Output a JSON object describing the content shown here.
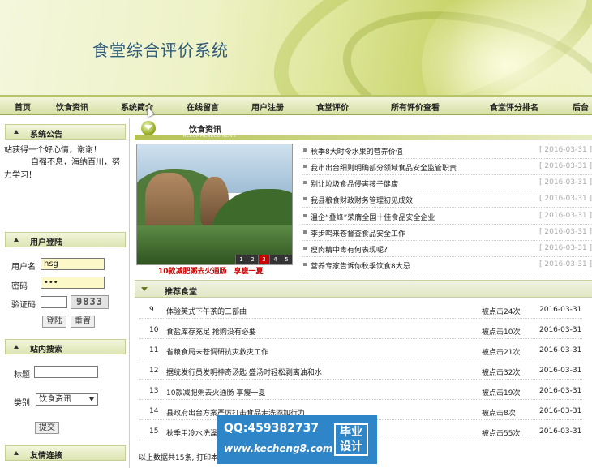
{
  "banner": {
    "title": "食堂综合评价系统"
  },
  "nav": [
    {
      "label": "首页"
    },
    {
      "label": "饮食资讯"
    },
    {
      "label": "系统简介"
    },
    {
      "label": "在线留言"
    },
    {
      "label": "用户注册"
    },
    {
      "label": "食堂评价"
    },
    {
      "label": "所有评价查看"
    },
    {
      "label": "食堂评分排名"
    },
    {
      "label": "后台"
    }
  ],
  "sidebar": {
    "notice": {
      "title": "系统公告",
      "line1": "站获得一个好心情，谢谢！",
      "line2": "自强不息，海纳百川，努力学习！"
    },
    "login": {
      "title": "用户登陆",
      "username_label": "用户名",
      "username_value": "hsg",
      "password_label": "密码",
      "password_value": "•••",
      "captcha_label": "验证码",
      "captcha_value": "",
      "captcha_image_text": "9833",
      "login_button": "登陆",
      "reset_button": "重置"
    },
    "search": {
      "title": "站内搜索",
      "title_label": "标题",
      "title_value": "",
      "category_label": "类别",
      "category_value": "饮食资讯",
      "submit_button": "提交"
    },
    "links": {
      "title": "友情连接"
    }
  },
  "news": {
    "title": "饮食资讯",
    "subtitle": "RECOMMENDED NEWS",
    "slideshow": {
      "pages": [
        "1",
        "2",
        "3",
        "4",
        "5"
      ],
      "active_page": "3",
      "caption": "10款减肥粥去火通肠　享瘦一夏"
    },
    "items": [
      {
        "title": "秋季8大时令水果的营养价值",
        "date": "[ 2016-03-31 ]"
      },
      {
        "title": "我市出台细则明确部分领域食品安全监管职责",
        "date": "[ 2016-03-31 ]"
      },
      {
        "title": "别让垃圾食品侵害孩子健康",
        "date": "[ 2016-03-31 ]"
      },
      {
        "title": "我县粮食财政财务管理初见成效",
        "date": "[ 2016-03-31 ]"
      },
      {
        "title": "温企“叠峰”荣膺全国十佳食品安全企业",
        "date": "[ 2016-03-31 ]"
      },
      {
        "title": "李步鸣来苍督查食品安全工作",
        "date": "[ 2016-03-31 ]"
      },
      {
        "title": "瘦肉精中毒有何表现呢？",
        "date": "[ 2016-03-31 ]"
      },
      {
        "title": "营养专家告诉你秋季饮食8大忌",
        "date": "[ 2016-03-31 ]"
      }
    ]
  },
  "recommend": {
    "title": "推荐食堂",
    "rows": [
      {
        "no": "9",
        "title": "体验英式下午茶的三部曲",
        "clicks": "被点击24次",
        "date": "2016-03-31"
      },
      {
        "no": "10",
        "title": "食盐库存充足  抢购没有必要",
        "clicks": "被点击10次",
        "date": "2016-03-31"
      },
      {
        "no": "11",
        "title": "省粮食局未苍调研抗灾救灾工作",
        "clicks": "被点击21次",
        "date": "2016-03-31"
      },
      {
        "no": "12",
        "title": "据统发行员发明神奇汤匙  盛汤时轻松剥离油和水",
        "clicks": "被点击32次",
        "date": "2016-03-31"
      },
      {
        "no": "13",
        "title": "10款减肥粥去火通肠  享瘦一夏",
        "clicks": "被点击19次",
        "date": "2016-03-31"
      },
      {
        "no": "14",
        "title": "县政府出台方案严厉打击食品走洗添加行为",
        "clicks": "被点击8次",
        "date": "2016-03-31"
      },
      {
        "no": "15",
        "title": "秋季用冷水洗澡有利于健康",
        "clicks": "被点击55次",
        "date": "2016-03-31"
      }
    ],
    "footer": "以上数据共15条, 打印本页"
  },
  "watermark": {
    "line1": "QQ:459382737",
    "line2": "www.kecheng8.com",
    "tag": "毕业设计"
  }
}
